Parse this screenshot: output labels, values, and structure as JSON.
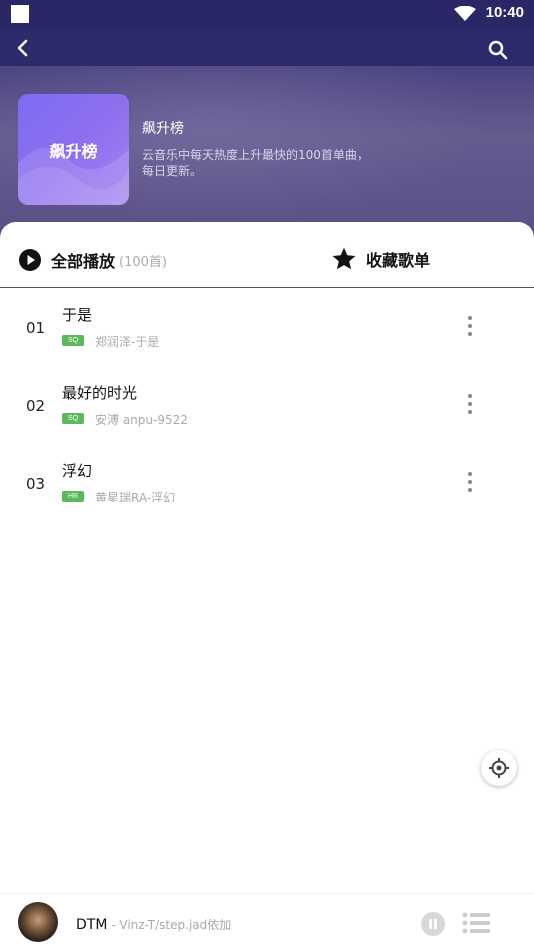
{
  "status_bar": {
    "time": "10:40"
  },
  "header": {
    "cover_text": "飙升榜",
    "title": "飙升榜",
    "description": "云音乐中每天热度上升最快的100首单曲，每日更新。"
  },
  "actions": {
    "play_all_label": "全部播放",
    "play_all_count": "(100首)",
    "collect_label": "收藏歌单"
  },
  "songs": [
    {
      "num": "01",
      "title": "于是",
      "badge": "SQ",
      "badge_color": "#5cb85c",
      "sub": "郑润泽-于是"
    },
    {
      "num": "02",
      "title": "最好的时光",
      "badge": "SQ",
      "badge_color": "#5cb85c",
      "sub": "安溥 anpu-9522"
    },
    {
      "num": "03",
      "title": "浮幻",
      "badge": "HR",
      "badge_color": "#5cb85c",
      "sub": "黄星瑞RA-浮幻"
    }
  ],
  "player": {
    "title": "DTM",
    "subtitle": " - Vinz-T/step.jad依加"
  },
  "colors": {
    "accent": "#5cb85c",
    "header": "#2d2a6c"
  }
}
